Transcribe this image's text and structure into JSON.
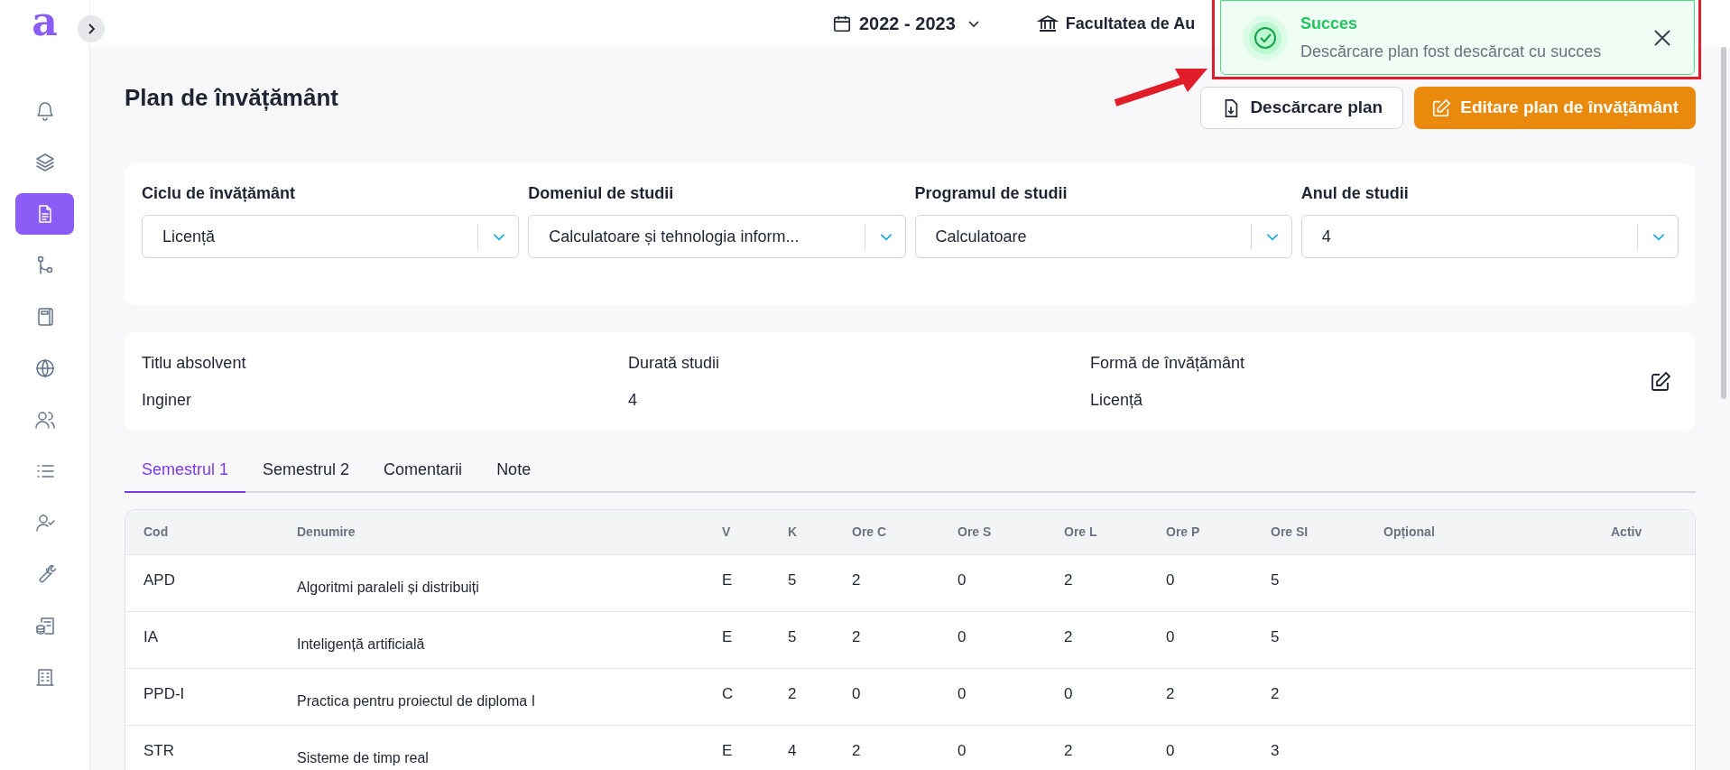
{
  "app": {
    "logo": "a"
  },
  "sidebar": {
    "items": [
      {
        "selected": false
      },
      {
        "selected": false
      },
      {
        "selected": true
      },
      {
        "selected": false
      },
      {
        "selected": false
      },
      {
        "selected": false
      },
      {
        "selected": false
      },
      {
        "selected": false
      },
      {
        "selected": false
      },
      {
        "selected": false
      },
      {
        "selected": false
      },
      {
        "selected": false
      }
    ]
  },
  "top_bar": {
    "year": "2022 - 2023",
    "faculty": "Facultatea de Au"
  },
  "toast": {
    "title": "Succes",
    "message": "Descărcare plan fost descărcat cu succes"
  },
  "page": {
    "title": "Plan de învățământ",
    "buttons": [
      {
        "label": "Descărcare plan",
        "kind": "secondary"
      },
      {
        "label": "Editare plan de învățământ",
        "kind": "primary"
      }
    ]
  },
  "filters": [
    {
      "label": "Ciclu de învățământ",
      "value": "Licență"
    },
    {
      "label": "Domeniul de studii",
      "value": "Calculatoare și tehnologia inform..."
    },
    {
      "label": "Programul de studii",
      "value": "Calculatoare"
    },
    {
      "label": "Anul de studii",
      "value": "4"
    }
  ],
  "details": [
    {
      "label": "Titlu absolvent",
      "value": "Inginer"
    },
    {
      "label": "Durată studii",
      "value": "4"
    },
    {
      "label": "Formă de învățământ",
      "value": "Licență"
    }
  ],
  "tabs": [
    {
      "label": "Semestrul 1",
      "selected": true
    },
    {
      "label": "Semestrul 2",
      "selected": false
    },
    {
      "label": "Comentarii",
      "selected": false
    },
    {
      "label": "Note",
      "selected": false
    }
  ],
  "table": {
    "columns": [
      "Cod",
      "Denumire",
      "V",
      "K",
      "Ore C",
      "Ore S",
      "Ore L",
      "Ore P",
      "Ore SI",
      "Opțional",
      "Activ"
    ],
    "rows": [
      [
        "APD",
        "Algoritmi paraleli și distribuiți",
        "E",
        "5",
        "2",
        "0",
        "2",
        "0",
        "5"
      ],
      [
        "IA",
        "Inteligență artificială",
        "E",
        "5",
        "2",
        "0",
        "2",
        "0",
        "5"
      ],
      [
        "PPD-I",
        "Practica pentru proiectul de diploma I",
        "C",
        "2",
        "0",
        "0",
        "0",
        "2",
        "2"
      ],
      [
        "STR",
        "Sisteme de timp real",
        "E",
        "4",
        "2",
        "0",
        "2",
        "0",
        "3"
      ]
    ]
  }
}
